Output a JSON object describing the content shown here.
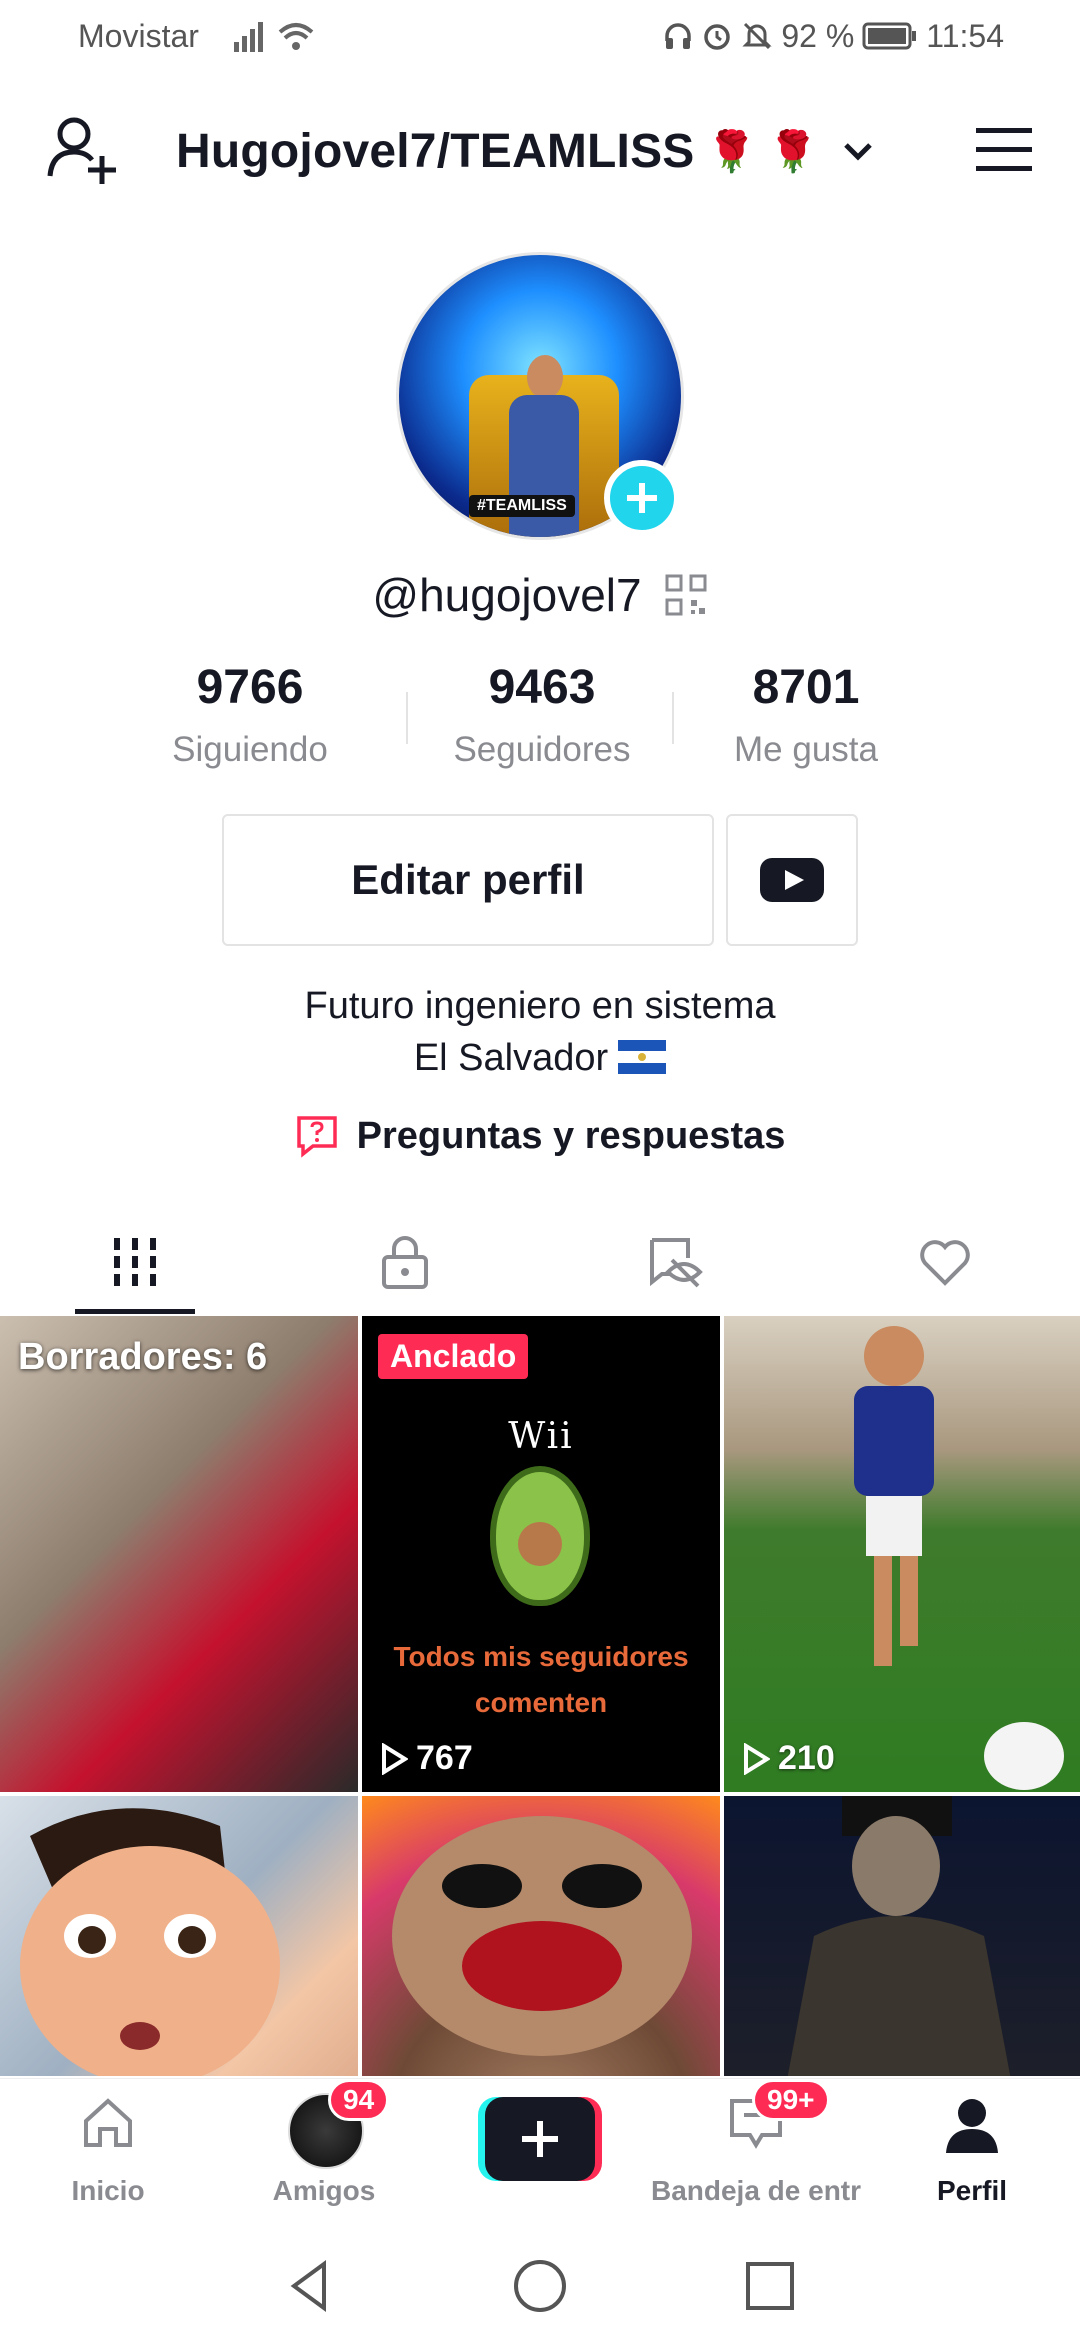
{
  "status_bar": {
    "carrier": "Movistar",
    "battery": "92 %",
    "time": "11:54"
  },
  "header": {
    "username": "Hugojovel7/TEAMLISS",
    "roses": [
      "🌹",
      "🌹"
    ]
  },
  "profile": {
    "avatar_tag": "#TEAMLISS",
    "handle": "@hugojovel7",
    "stats": [
      {
        "value": "9766",
        "label": "Siguiendo"
      },
      {
        "value": "9463",
        "label": "Seguidores"
      },
      {
        "value": "8701",
        "label": "Me gusta"
      }
    ],
    "edit_button": "Editar perfil",
    "bio_line1": "Futuro ingeniero en sistema",
    "bio_line2": "El Salvador",
    "qa_label": "Preguntas y respuestas"
  },
  "tabs": [
    {
      "icon": "grid-icon",
      "active": true
    },
    {
      "icon": "lock-icon",
      "active": false
    },
    {
      "icon": "hidden-icon",
      "active": false
    },
    {
      "icon": "heart-icon",
      "active": false
    }
  ],
  "videos": [
    {
      "overlay": "Borradores: 6"
    },
    {
      "badge": "Anclado",
      "wii": "Wii",
      "caption": "Todos mis seguidores comenten",
      "views": "767"
    },
    {
      "views": "210"
    },
    {},
    {},
    {}
  ],
  "bottom_nav": {
    "items": [
      {
        "label": "Inicio"
      },
      {
        "label": "Amigos",
        "badge": "94"
      },
      {
        "label": ""
      },
      {
        "label": "Bandeja de entr",
        "badge": "99+"
      },
      {
        "label": "Perfil"
      }
    ]
  },
  "colors": {
    "accent_red": "#fe2c55",
    "accent_cyan": "#25f4ee",
    "text_primary": "#161823",
    "text_secondary": "#8a8b91"
  }
}
